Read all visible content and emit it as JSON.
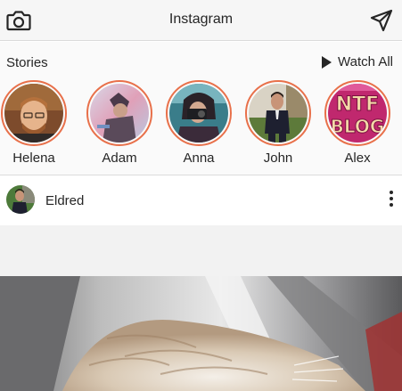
{
  "header": {
    "title": "Instagram",
    "left_icon": "camera-icon",
    "right_icon": "paper-plane-icon"
  },
  "stories": {
    "heading": "Stories",
    "watch_all_label": "Watch All",
    "watch_all_icon": "play-icon",
    "items": [
      {
        "name": "Helena"
      },
      {
        "name": "Adam"
      },
      {
        "name": "Anna"
      },
      {
        "name": "John"
      },
      {
        "name": "Alex"
      }
    ]
  },
  "post": {
    "username": "Eldred",
    "menu_icon": "more-vertical-icon"
  },
  "colors": {
    "story_ring": "#e8704a",
    "text": "#262626",
    "divider": "#dbdbdb"
  }
}
